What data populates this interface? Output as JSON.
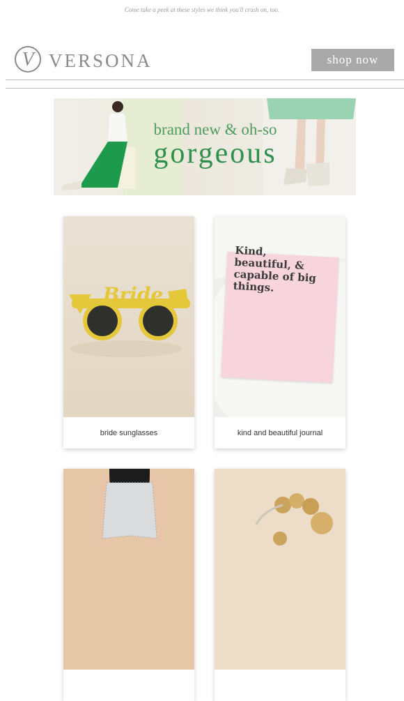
{
  "preheader": "Come take a peek at these styles we think you'll crush on, too.",
  "header": {
    "brand_name": "VERSONA",
    "logo_letter": "V",
    "cta_label": "shop now"
  },
  "hero": {
    "line1": "brand new & oh-so",
    "line2": "gorgeous"
  },
  "products": [
    {
      "label": "bride sunglasses",
      "image_text": "Bride"
    },
    {
      "label": "kind and beautiful journal",
      "image_text": "Kind, beautiful, & capable of big things."
    }
  ],
  "colors": {
    "button_bg": "#a9a9a9",
    "brand_grey": "#8a8a8a",
    "hero_green": "#2f8f4c"
  }
}
